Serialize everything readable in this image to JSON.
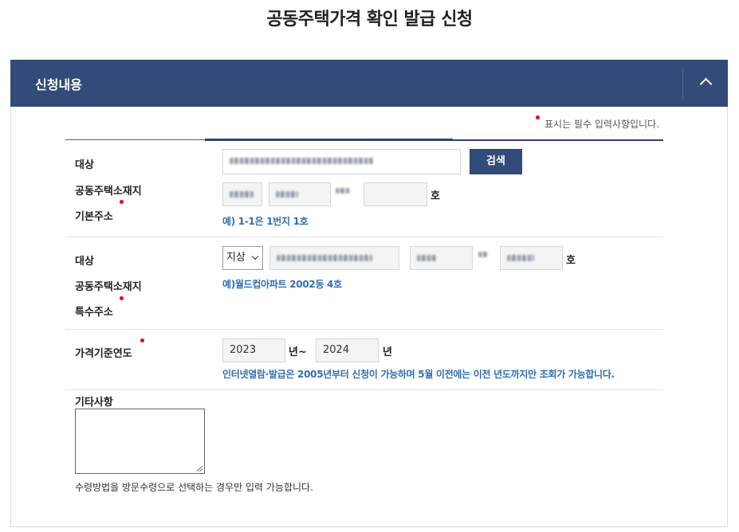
{
  "page": {
    "title": "공동주택가격 확인 발급 신청"
  },
  "panel": {
    "title": "신청내용",
    "toggle_icon": "chevron-up-icon"
  },
  "required_note": "표시는 필수 입력사항입니다.",
  "basic_address": {
    "label_line1": "대상",
    "label_line2": "공동주택소재지",
    "label_line3": "기본주소",
    "search_button": "검색",
    "ho_unit": "호",
    "hint": "예) 1-1은 1번지 1호"
  },
  "special_address": {
    "label_line1": "대상",
    "label_line2": "공동주택소재지",
    "label_line3": "특수주소",
    "select_value": "지상",
    "ho_unit": "호",
    "hint": "예)월드컵아파트 2002동 4호"
  },
  "price_year": {
    "label": "가격기준연도",
    "from_value": "2023",
    "from_unit": "년~",
    "to_value": "2024",
    "to_unit": "년",
    "hint": "인터넷열람·발급은 2005년부터 신청이 가능하며 5월 이전에는 이전 년도까지만 조회가 가능합니다."
  },
  "etc": {
    "label": "기타사항",
    "textarea_value": "",
    "note": "수령방법을 방문수령으로 선택하는 경우만 입력 가능합니다."
  },
  "colors": {
    "header": "#324b78",
    "required": "#e60012",
    "hint": "#2f6fb5"
  }
}
